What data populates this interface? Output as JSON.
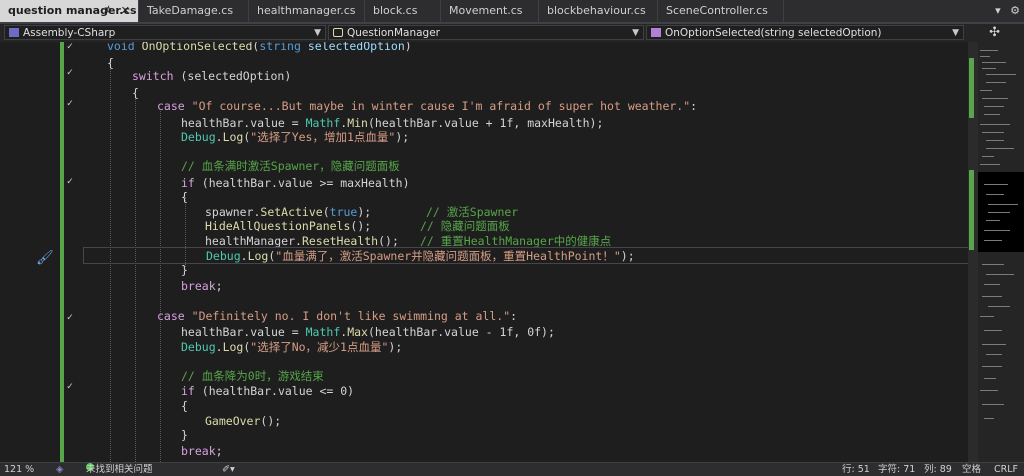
{
  "tabs": [
    {
      "label": "question manager.cs",
      "active": true,
      "pin": "⊅",
      "close": "✕"
    },
    {
      "label": "TakeDamage.cs"
    },
    {
      "label": "healthmanager.cs"
    },
    {
      "label": "block.cs"
    },
    {
      "label": "Movement.cs"
    },
    {
      "label": "blockbehaviour.cs"
    },
    {
      "label": "SceneController.cs"
    }
  ],
  "tab_tools": {
    "overflow": "▾",
    "settings": "⚙"
  },
  "navbar": {
    "project": "Assembly-CSharp",
    "class": "QuestionManager",
    "member": "OnOptionSelected(string selectedOption)",
    "split": "✣"
  },
  "code": {
    "l1_kw": "void",
    "l1_fn": "OnOptionSelected",
    "l1_p1": "(",
    "l1_kw2": "string",
    "l1_var": "selectedOption",
    "l1_p2": ")",
    "brace_open": "{",
    "brace_close": "}",
    "switch_kw": "switch",
    "switch_arg": "(selectedOption)",
    "case_kw": "case",
    "case1_str": "\"Of course...But maybe in winter cause I'm afraid of super hot weather.\"",
    "colon": ":",
    "healthBar_value": "healthBar.value = ",
    "mathf": "Mathf",
    "min": "Min",
    "max": "Max",
    "min_args": "(healthBar.value + 1f, maxHealth);",
    "max_args": "(healthBar.value - 1f, 0f);",
    "debug": "Debug",
    "log": "Log",
    "log1_str": "\"选择了Yes，增加1点血量\"",
    "log_end": ");",
    "comment1": "// 血条满时激活Spawner，隐藏问题面板",
    "if_kw": "if",
    "if1_cond": " (healthBar.value >= maxHealth)",
    "spawner": "spawner.",
    "setactive": "SetActive",
    "true_kw": "true",
    "setactive_end": ");",
    "comment_spawner": "// 激活Spawner",
    "hide_fn": "HideAllQuestionPanels",
    "hide_end": "();",
    "comment_hide": "// 隐藏问题面板",
    "hm": "healthManager.",
    "reset_fn": "ResetHealth",
    "reset_end": "();",
    "comment_reset": "// 重置HealthManager中的健康点",
    "log2_str": "\"血量满了，激活Spawner并隐藏问题面板，重置HealthPoint！\"",
    "break_kw": "break",
    "semi": ";",
    "case2_str": "\"Definitely no. I don't like swimming at all.\"",
    "log3_str": "\"选择了No，减少1点血量\"",
    "comment2": "// 血条降为0时，游戏结束",
    "if2_cond": " (healthBar.value <= 0)",
    "gameover_fn": "GameOver",
    "gameover_end": "();"
  },
  "status": {
    "zoom": "121 %",
    "issues": "未找到相关问题",
    "line": "行: 51",
    "char": "字符: 71",
    "col": "列: 89",
    "whitespace": "空格",
    "eol": "CRLF"
  },
  "colors": {
    "keyword": "#569cd6",
    "control": "#d8a0df",
    "type": "#4ec9b0",
    "method": "#dcdcaa",
    "string": "#d69d85",
    "comment": "#57a64a",
    "change_bar": "#57a64a"
  }
}
